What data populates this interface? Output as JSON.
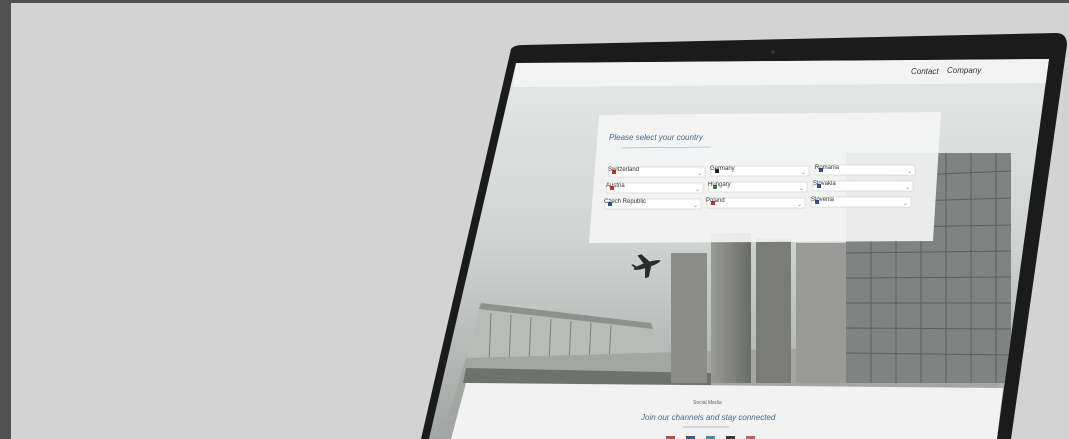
{
  "nav": {
    "contact_label": "Contact",
    "company_label": "Company"
  },
  "country_panel": {
    "title": "Please select your country",
    "countries": [
      "Switzerland",
      "Germany",
      "Romania",
      "Austria",
      "Hungary",
      "Slovakia",
      "Czech Republic",
      "Poland",
      "Slovenia"
    ]
  },
  "social": {
    "title": "Social Media",
    "tagline": "Join our channels and stay connected"
  },
  "colors": {
    "background": "#d3d3d3",
    "outer_frame": "#505050",
    "laptop_bezel": "#1a1a1a",
    "accent_text": "#4a6a8a"
  }
}
